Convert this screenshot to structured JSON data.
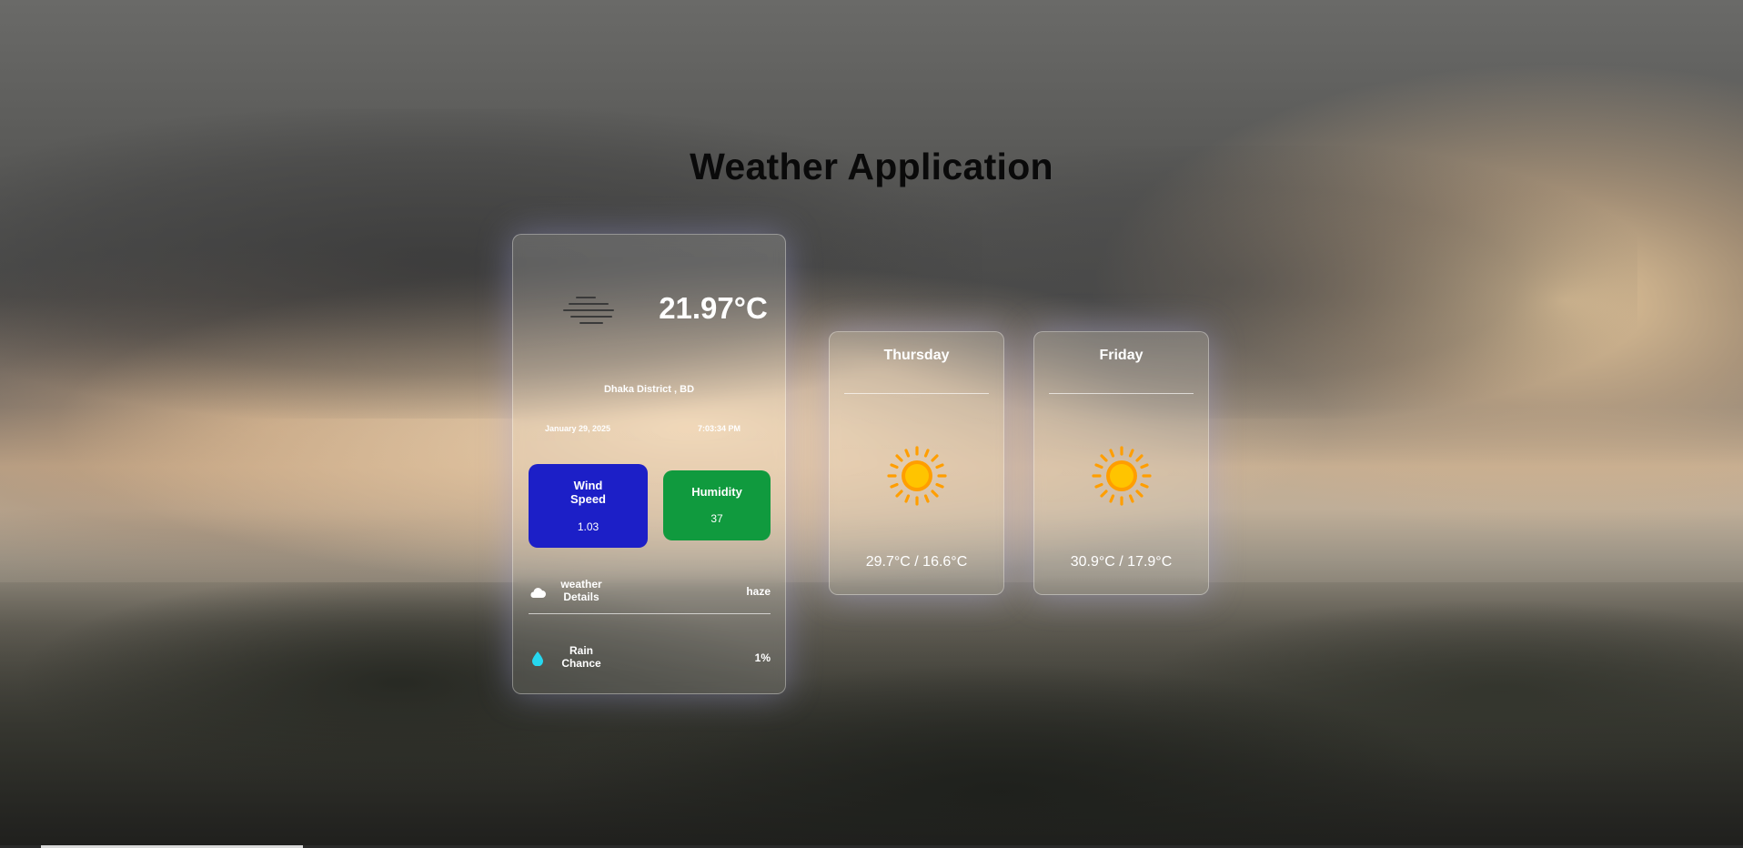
{
  "app": {
    "title": "Weather Application"
  },
  "current": {
    "condition_icon": "haze-icon",
    "temperature": "21.97°C",
    "location": "Dhaka District , BD",
    "date": "January 29, 2025",
    "time": "7:03:34 PM",
    "wind": {
      "label_line1": "Wind",
      "label_line2": "Speed",
      "value": "1.03",
      "color": "#1c1fc7"
    },
    "humidity": {
      "label": "Humidity",
      "value": "37",
      "color": "#109a3e"
    },
    "details": {
      "icon": "cloud-icon",
      "label_line1": "weather",
      "label_line2": "Details",
      "value": "haze"
    },
    "rain": {
      "icon": "water-drop-icon",
      "label_line1": "Rain",
      "label_line2": "Chance",
      "value": "1%"
    }
  },
  "forecast": [
    {
      "day": "Thursday",
      "icon": "sun-icon",
      "range": "29.7°C / 16.6°C"
    },
    {
      "day": "Friday",
      "icon": "sun-icon",
      "range": "30.9°C / 17.9°C"
    }
  ],
  "colors": {
    "title": "#0a0a0a",
    "sun_core": "#ffc400",
    "sun_ray": "#ff9e00",
    "drop": "#26d7ef"
  }
}
